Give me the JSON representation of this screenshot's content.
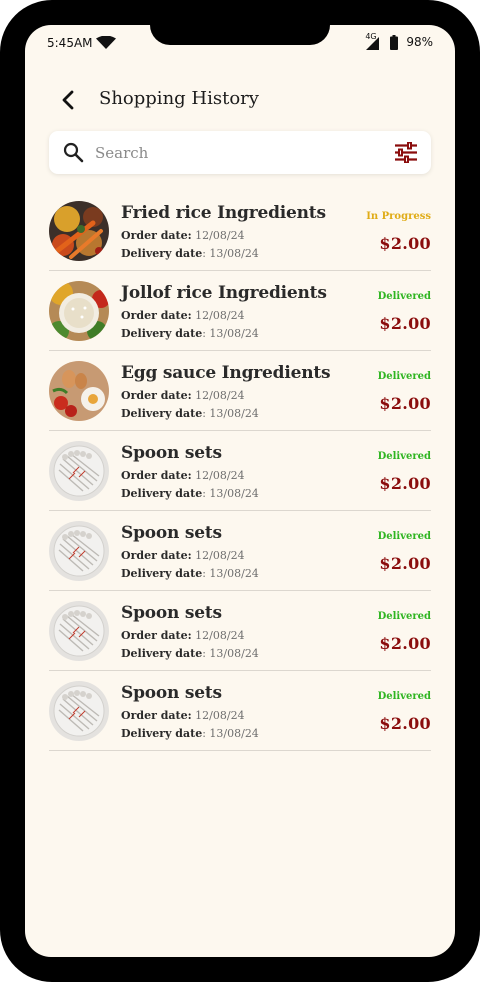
{
  "status_bar": {
    "time": "5:45AM",
    "network_label": "4G",
    "battery": "98%"
  },
  "header": {
    "title": "Shopping History"
  },
  "search": {
    "placeholder": "Search"
  },
  "labels": {
    "order_date": "Order date:",
    "delivery_date": "Delivery date"
  },
  "colors": {
    "in_progress": "#e0ac17",
    "delivered": "#2fb521",
    "price": "#8b0d0d",
    "background": "#fdf8ef"
  },
  "orders": [
    {
      "name": "Fried rice Ingredients",
      "order_date": "12/08/24",
      "delivery_date": "13/08/24",
      "status": "In Progress",
      "price": "$2.00",
      "image": "spices-image"
    },
    {
      "name": "Jollof rice Ingredients",
      "order_date": "12/08/24",
      "delivery_date": "13/08/24",
      "status": "Delivered",
      "price": "$2.00",
      "image": "rice-bowl-image"
    },
    {
      "name": "Egg sauce Ingredients",
      "order_date": "12/08/24",
      "delivery_date": "13/08/24",
      "status": "Delivered",
      "price": "$2.00",
      "image": "eggs-image"
    },
    {
      "name": "Spoon sets",
      "order_date": "12/08/24",
      "delivery_date": "13/08/24",
      "status": "Delivered",
      "price": "$2.00",
      "image": "spoons-image"
    },
    {
      "name": "Spoon sets",
      "order_date": "12/08/24",
      "delivery_date": "13/08/24",
      "status": "Delivered",
      "price": "$2.00",
      "image": "spoons-image"
    },
    {
      "name": "Spoon sets",
      "order_date": "12/08/24",
      "delivery_date": "13/08/24",
      "status": "Delivered",
      "price": "$2.00",
      "image": "spoons-image"
    },
    {
      "name": "Spoon sets",
      "order_date": "12/08/24",
      "delivery_date": "13/08/24",
      "status": "Delivered",
      "price": "$2.00",
      "image": "spoons-image"
    }
  ]
}
